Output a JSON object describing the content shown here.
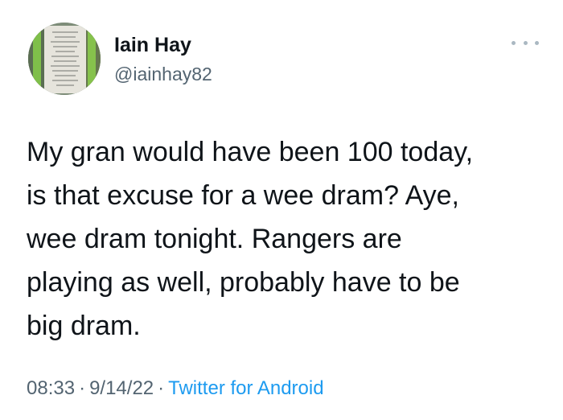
{
  "tweet": {
    "author": {
      "display_name": "Iain Hay",
      "handle": "@iainhay82"
    },
    "text": "My gran would have been 100 today,\nis that excuse for a wee dram? Aye,\nwee dram tonight. Rangers are\nplaying as well, probably have to be\nbig dram.",
    "time": "08:33",
    "date": "9/14/22",
    "source": "Twitter for Android",
    "separator": "·",
    "more_icon": "more-horizontal-icon"
  }
}
